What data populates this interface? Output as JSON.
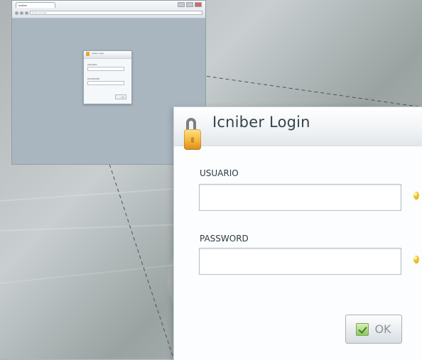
{
  "thumbnail": {
    "tab_title": "Icniber",
    "address": "icniber.example",
    "mini_title": "Icniber Login",
    "mini_username_label": "USUARIO",
    "mini_password_label": "PASSWORD",
    "mini_ok_label": "OK"
  },
  "login": {
    "title": "Icniber Login",
    "username_label": "USUARIO",
    "username_value": "",
    "password_label": "PASSWORD",
    "password_value": "",
    "ok_label": "OK"
  },
  "icons": {
    "lock": "lock-icon",
    "required": "required-indicator-icon",
    "check": "check-icon"
  },
  "colors": {
    "window_background": "#fbfdff",
    "title_text": "#34444d",
    "lock_gold": "#f5b73b",
    "ok_text": "#8a9399"
  }
}
